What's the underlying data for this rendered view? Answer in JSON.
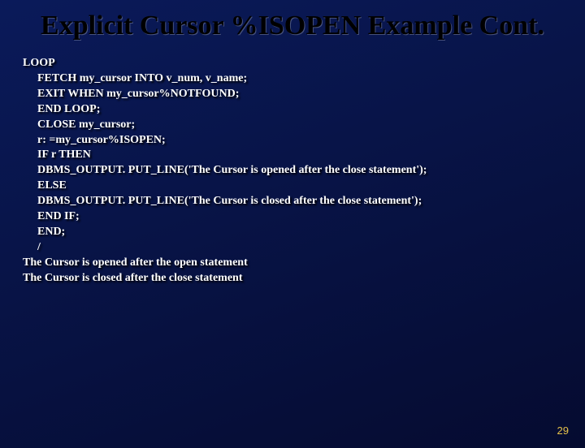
{
  "title": "Explicit Cursor %ISOPEN Example Cont.",
  "code": {
    "l1": "LOOP",
    "l2": "FETCH my_cursor INTO v_num, v_name;",
    "l3": "EXIT WHEN my_cursor%NOTFOUND;",
    "l4": "END LOOP;",
    "l5": "CLOSE my_cursor;",
    "l6": "r: =my_cursor%ISOPEN;",
    "l7": "IF r THEN",
    "l8": "DBMS_OUTPUT. PUT_LINE('The Cursor is opened after the close statement');",
    "l9": "ELSE",
    "l10": "DBMS_OUTPUT. PUT_LINE('The Cursor is closed after the close statement');",
    "l11": "END IF;",
    "l12": "END;",
    "l13": "/",
    "l14": "The Cursor is opened after the open statement",
    "l15": "The Cursor is closed after the close statement"
  },
  "page_number": "29"
}
